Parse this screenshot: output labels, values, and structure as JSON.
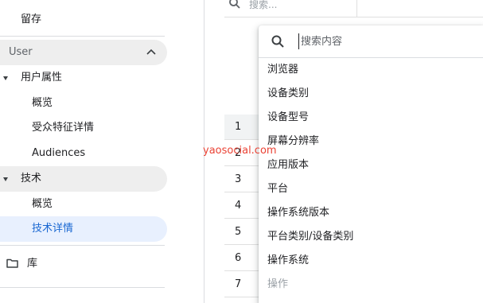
{
  "sidebar": {
    "retention_label": "留存",
    "user_section_label": "User",
    "user_attributes_label": "用户属性",
    "user_attr_overview_label": "概览",
    "audience_details_label": "受众特征详情",
    "audiences_label": "Audiences",
    "tech_label": "技术",
    "tech_overview_label": "概览",
    "tech_details_label": "技术详情",
    "library_label": "库"
  },
  "background": {
    "search_placeholder": "搜索...",
    "row_numbers": [
      "1",
      "2",
      "3",
      "4",
      "5",
      "6",
      "7"
    ]
  },
  "dropdown": {
    "search_placeholder": "搜索内容",
    "items": [
      "浏览器",
      "设备类别",
      "设备型号",
      "屏幕分辨率",
      "应用版本",
      "平台",
      "操作系统版本",
      "平台类别/设备类别",
      "操作系统",
      "操作"
    ]
  },
  "watermark": "yaosocial.com",
  "colors": {
    "selected_bg": "#e8f0fe",
    "selected_text": "#1967d2",
    "hover_bg": "#eeeeee",
    "watermark": "#ea4335"
  }
}
